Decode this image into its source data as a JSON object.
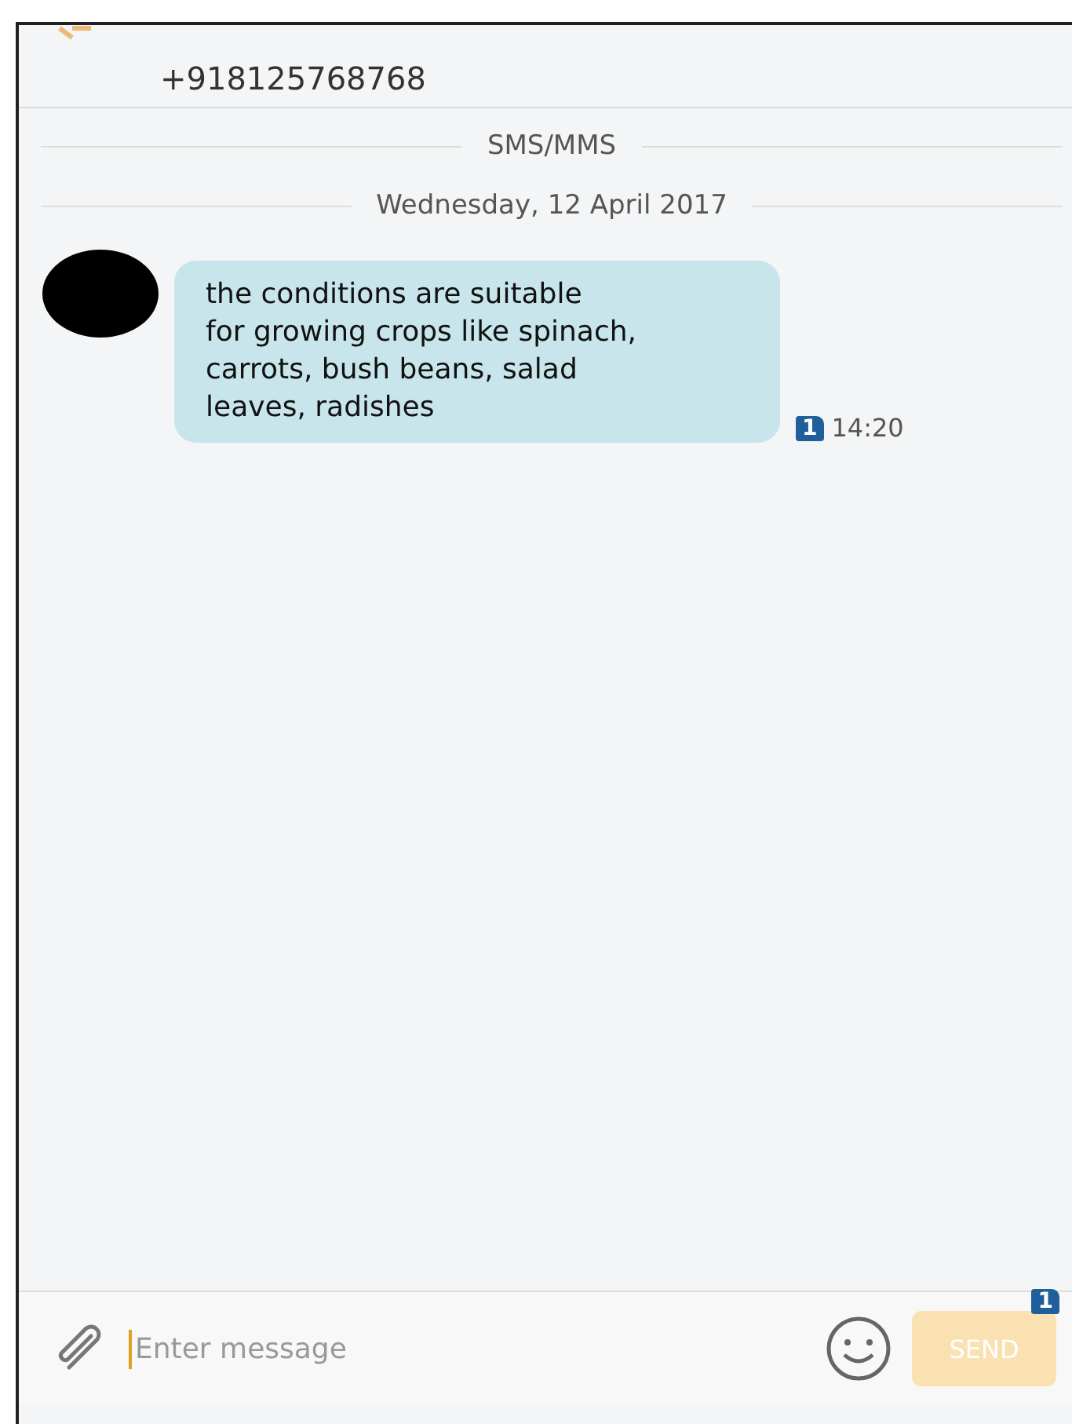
{
  "header": {
    "contact": "+918125768768"
  },
  "dividers": [
    {
      "label": "SMS/MMS"
    },
    {
      "label": "Wednesday, 12 April 2017"
    }
  ],
  "messages": [
    {
      "text": "the conditions are suitable\nfor growing crops like spinach,\ncarrots, bush beans, salad\nleaves, radishes",
      "sim": "1",
      "time": "14:20"
    }
  ],
  "composer": {
    "placeholder": "Enter message",
    "send": "SEND",
    "send_disabled": true,
    "sim": "1"
  }
}
